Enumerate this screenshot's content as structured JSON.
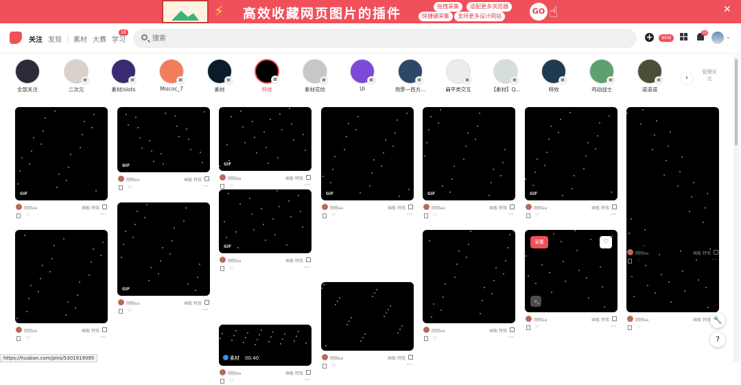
{
  "banner": {
    "headline": "高效收藏网页图片的插件",
    "chips": [
      "拖拽采集",
      "适配更多浏览器",
      "快捷键采集",
      "支持更多设计网站"
    ],
    "go_label": "GO"
  },
  "nav": {
    "links": [
      "关注",
      "发现",
      "素材",
      "大赛",
      "学习"
    ],
    "active": "关注",
    "learn_badge": "18",
    "search_placeholder": "搜索",
    "new_badge": "NEW",
    "bell_badge": "10"
  },
  "circles": {
    "items": [
      {
        "label": "全部关注",
        "color": "#2b2b3a"
      },
      {
        "label": "二次元",
        "color": "#d9d1cc"
      },
      {
        "label": "素材/slots",
        "color": "#3a2a72"
      },
      {
        "label": "Miscoc_7",
        "color": "#f37c5c"
      },
      {
        "label": "素材",
        "color": "#0b1d2c"
      },
      {
        "label": "特效",
        "color": "#000000",
        "active": true
      },
      {
        "label": "素材花纹",
        "color": "#c8c8c8"
      },
      {
        "label": "UI",
        "color": "#7b4bd8"
      },
      {
        "label": "场景—西方...",
        "color": "#2e4766"
      },
      {
        "label": "扁平类交互",
        "color": "#ececec"
      },
      {
        "label": "【素材】Q...",
        "color": "#d5ded8"
      },
      {
        "label": "特效",
        "color": "#1d3a4e"
      },
      {
        "label": "鸡动战士",
        "color": "#5fa070"
      },
      {
        "label": "道道道",
        "color": "#4a5038"
      }
    ],
    "manage_label": "管理关注"
  },
  "pins": [
    {
      "col": 0,
      "author": "刚刚aa",
      "tags": "画板 特效",
      "gif": "GIF"
    },
    {
      "col": 0,
      "author": "刚刚aa",
      "tags": "画板 特效",
      "gif": ""
    },
    {
      "col": 1,
      "author": "刚刚aa",
      "tags": "画板 特效",
      "gif": "GIF"
    },
    {
      "col": 1,
      "author": "刚刚aa",
      "tags": "画板 特效",
      "gif": "GIF"
    },
    {
      "col": 2,
      "author": "刚刚aa",
      "tags": "画板 特效",
      "tag": "素材",
      "duration": "00:40"
    },
    {
      "col": 2,
      "author": "刚刚aa",
      "tags": "画板 特效",
      "gif": "GIF"
    },
    {
      "col": 2,
      "author": "刚刚aa",
      "tags": "画板 特效",
      "gif": "GIF"
    },
    {
      "col": 3,
      "author": "刚刚aa",
      "tags": "画板 特效",
      "gif": ""
    },
    {
      "col": 3,
      "author": "刚刚aa",
      "tags": "画板 特效",
      "gif": "GIF"
    },
    {
      "col": 4,
      "author": "刚刚aa",
      "tags": "画板 特效",
      "gif": ""
    },
    {
      "col": 4,
      "author": "刚刚aa",
      "tags": "画板 特效",
      "gif": "GIF"
    },
    {
      "col": 5,
      "author": "刚刚aa",
      "tags": "画板 特效",
      "collect": "采集"
    },
    {
      "col": 5,
      "author": "刚刚aa",
      "tags": "画板 特效",
      "gif": "GIF"
    },
    {
      "col": 6,
      "author": "刚刚aa",
      "tags": "画板 特效",
      "gif": ""
    },
    {
      "col": 6,
      "author": "刚刚aa",
      "tags": "画板 特效",
      "gif": ""
    }
  ],
  "status_url": "https://huaban.com/pins/5301919095"
}
